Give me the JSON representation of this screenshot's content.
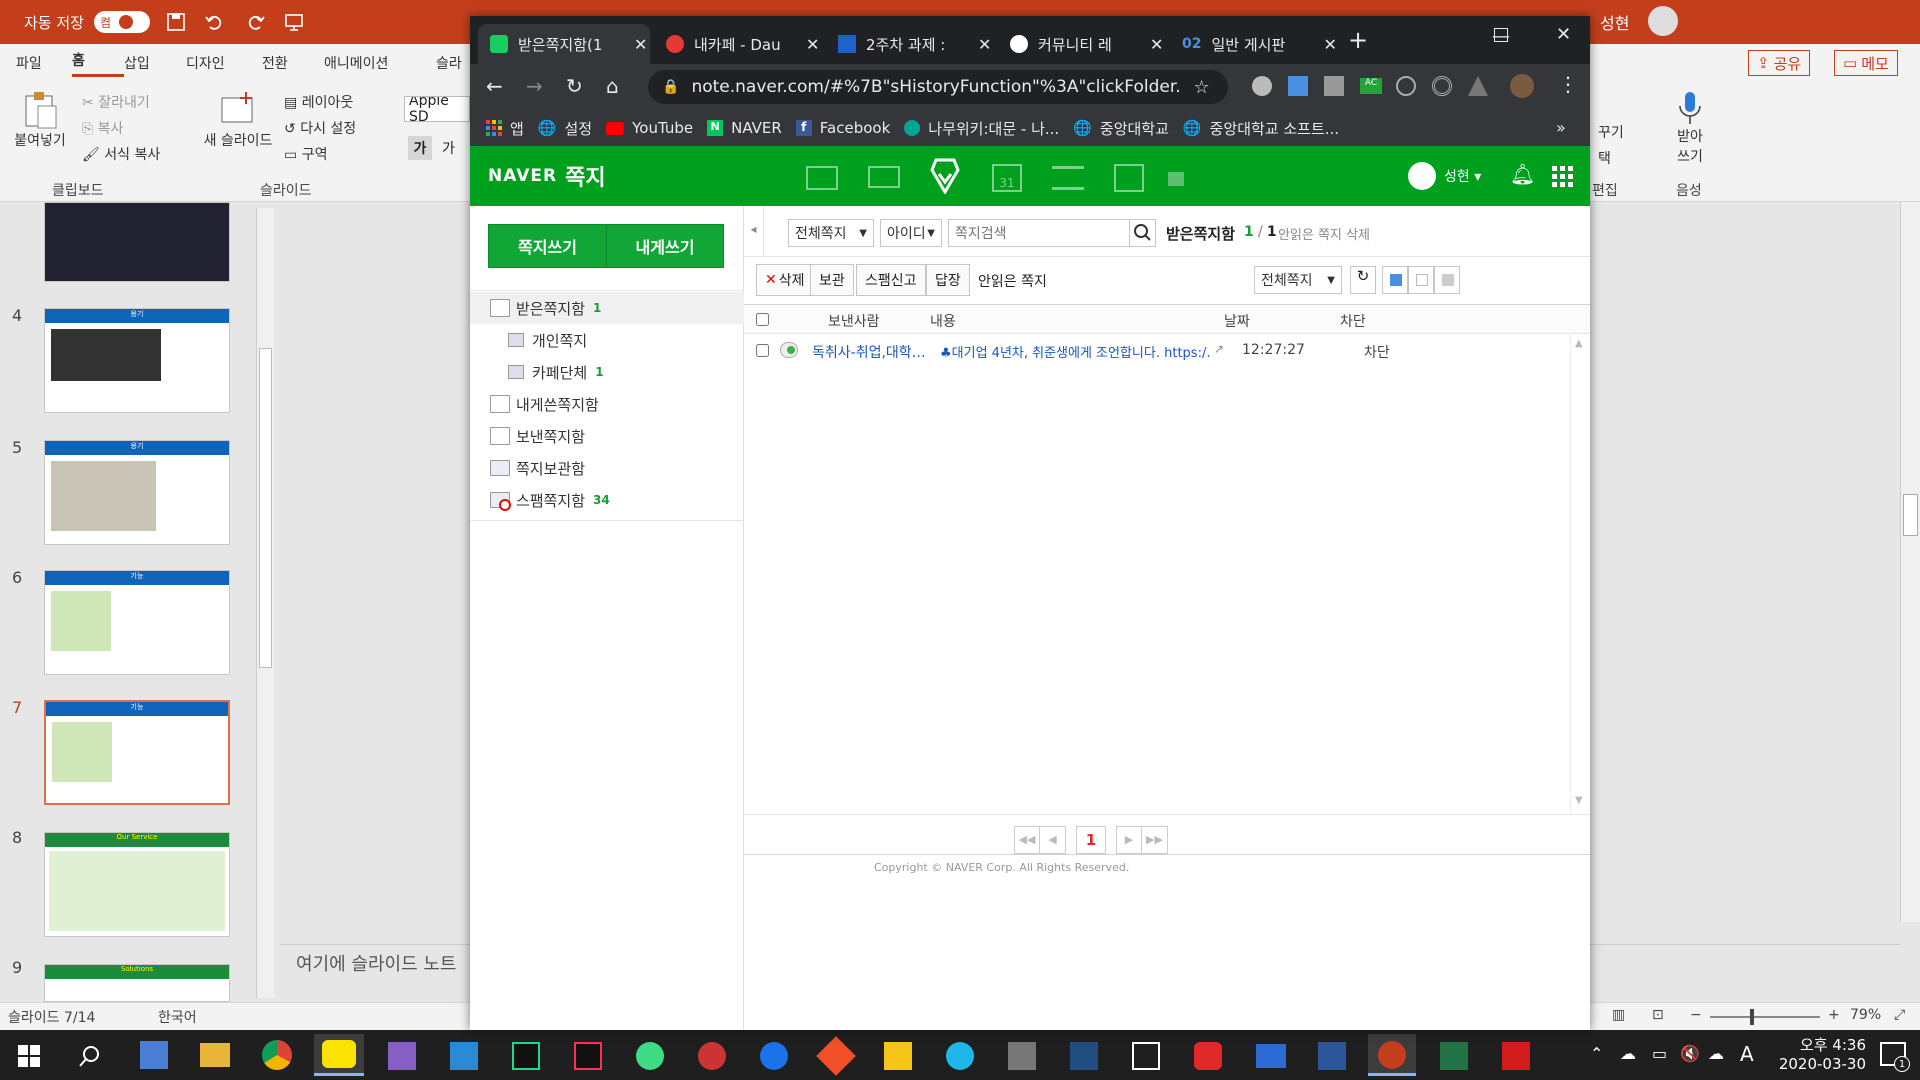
{
  "powerpoint": {
    "autosave_label": "자동 저장",
    "autosave_state": "켬",
    "user": "성현",
    "menu": [
      "파일",
      "홈",
      "삽입",
      "디자인",
      "전환",
      "애니메이션",
      "슬라"
    ],
    "share_label": "공유",
    "memo_label": "메모",
    "ribbon": {
      "paste": "붙여넣기",
      "cut": "잘라내기",
      "copy": "복사",
      "format_painter": "서식 복사",
      "clipboard_group": "클립보드",
      "new_slide": "새 슬라이드",
      "layout": "레이아웃",
      "reset": "다시 설정",
      "section": "구역",
      "slides_group": "슬라이드",
      "font_name": "Apple SD",
      "bold": "가",
      "font_extra": "가",
      "decorate": "꾸기",
      "select": "택",
      "edit_group": "편집",
      "dictate_line1": "받아",
      "dictate_line2": "쓰기",
      "voice_group": "음성"
    },
    "thumbnail_numbers": [
      "4",
      "5",
      "6",
      "7",
      "8",
      "9"
    ],
    "thumb_titles": [
      "용기",
      "용기",
      "기능",
      "기능",
      "Our Service",
      "Solutions"
    ],
    "notes_placeholder": "여기에 슬라이드 노트",
    "status": {
      "slide_counter": "슬라이드 7/14",
      "language": "한국어",
      "zoom": "79%"
    }
  },
  "chrome": {
    "tabs": [
      {
        "label": "받은쪽지함(1"
      },
      {
        "label": "내카페 - Dau"
      },
      {
        "label": "2주차 과제 :"
      },
      {
        "label": "커뮤니티 레"
      },
      {
        "label": "일반 게시판",
        "badge": "02"
      }
    ],
    "new_tab": "+",
    "url": "note.naver.com/#%7B\"sHistoryFunction\"%3A\"clickFolder...",
    "bookmarks": [
      "앱",
      "설정",
      "YouTube",
      "NAVER",
      "Facebook",
      "나무위키:대문 - 나...",
      "중앙대학교",
      "중앙대학교 소프트..."
    ]
  },
  "naver": {
    "logo": "NAVER",
    "service": "쪽지",
    "user": "성현",
    "write_button": "쪽지쓰기",
    "write_self_button": "내게쓰기",
    "folders": [
      {
        "label": "받은쪽지함",
        "count": "1"
      },
      {
        "label": "개인쪽지",
        "count": ""
      },
      {
        "label": "카페단체",
        "count": "1"
      },
      {
        "label": "내게쓴쪽지함",
        "count": ""
      },
      {
        "label": "보낸쪽지함",
        "count": ""
      },
      {
        "label": "쪽지보관함",
        "count": ""
      },
      {
        "label": "스팸쪽지함",
        "count": "34"
      }
    ],
    "search": {
      "scope": "전체쪽지",
      "field": "아이디",
      "placeholder": "쪽지검색",
      "folder_title": "받은쪽지함",
      "count_unread": "1",
      "count_total": "1",
      "delete_unread": "안읽은 쪽지 삭제"
    },
    "toolbar": {
      "delete": "삭제",
      "keep": "보관",
      "spam": "스팸신고",
      "reply": "답장",
      "unread": "안읽은 쪽지",
      "filter": "전체쪽지"
    },
    "columns": [
      "보낸사람",
      "내용",
      "날짜",
      "차단"
    ],
    "rows": [
      {
        "sender": "독취사-취업,대학…",
        "content": "♣대기업 4년차, 취준생에게 조언합니다. https:/…",
        "date": "12:27:27",
        "block": "차단"
      }
    ],
    "pagination": {
      "current": "1"
    },
    "footer_text": "Copyright © NAVER Corp. All Rights Reserved."
  },
  "taskbar": {
    "time": "오후 4:36",
    "date": "2020-03-30",
    "ime": "A",
    "notifications": "1"
  }
}
